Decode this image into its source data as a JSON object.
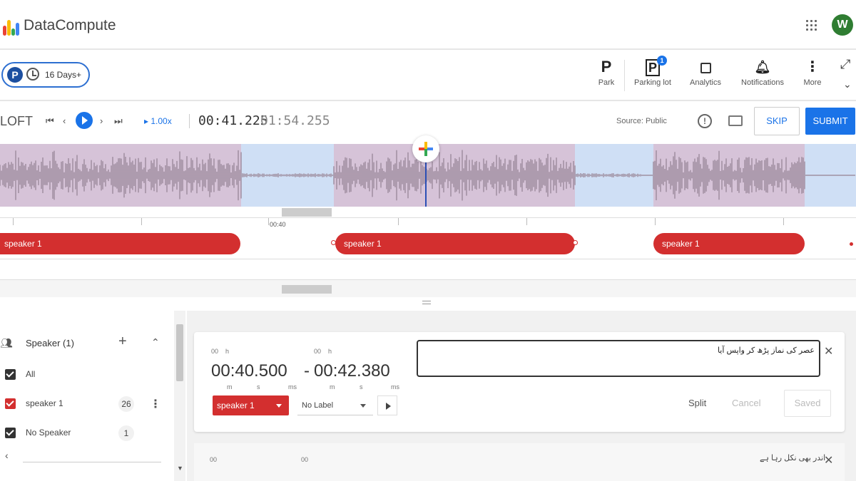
{
  "app": {
    "name": "DataCompute",
    "avatar_initial": "W",
    "logo_colors": [
      "#ea4335",
      "#fbbc05",
      "#34a853",
      "#4285f4"
    ]
  },
  "toolbar": {
    "pill_badge": "P",
    "pill_text": "16 Days+",
    "tools": [
      {
        "icon": "P",
        "label": "Park"
      },
      {
        "icon": "P",
        "label": "Parking lot",
        "badge": "1"
      },
      {
        "icon": "analytics-icon",
        "label": "Analytics"
      },
      {
        "icon": "bell-icon",
        "label": "Notifications"
      },
      {
        "icon": "more-vert-icon",
        "label": "More"
      }
    ]
  },
  "player": {
    "title": "LOFT",
    "speed": "1.00x",
    "current_time": "00:41.225",
    "total_time": "01:54.255",
    "source": "Source: Public",
    "skip_label": "SKIP",
    "submit_label": "SUBMIT"
  },
  "timeline": {
    "ruler_label": "00:40",
    "speaker_segments": [
      {
        "label": "speaker 1"
      },
      {
        "label": "speaker 1"
      },
      {
        "label": "speaker 1"
      }
    ]
  },
  "speakers_panel": {
    "title": "Speaker (1)",
    "items": [
      {
        "label": "All",
        "checked": true,
        "color": "#333333",
        "count": ""
      },
      {
        "label": "speaker 1",
        "checked": true,
        "color": "#d32f2f",
        "count": "26"
      },
      {
        "label": "No Speaker",
        "checked": true,
        "color": "#333333",
        "count": "1"
      }
    ]
  },
  "segment": {
    "start_hours": "00",
    "start_h_unit": "h",
    "start_time": "00:40.500",
    "end_hours": "00",
    "end_h_unit": "h",
    "end_time": "00:42.380",
    "units": [
      "m",
      "s",
      "ms",
      "m",
      "s",
      "ms"
    ],
    "transcript": "عصر کی نماز پڑھ کر واپس آیا",
    "speaker": "speaker 1",
    "label": "No Label",
    "split_label": "Split",
    "cancel_label": "Cancel",
    "saved_label": "Saved"
  },
  "segment2": {
    "start_hours": "00",
    "end_hours": "00",
    "transcript": "اندر بھی نکل رہا ہے"
  }
}
